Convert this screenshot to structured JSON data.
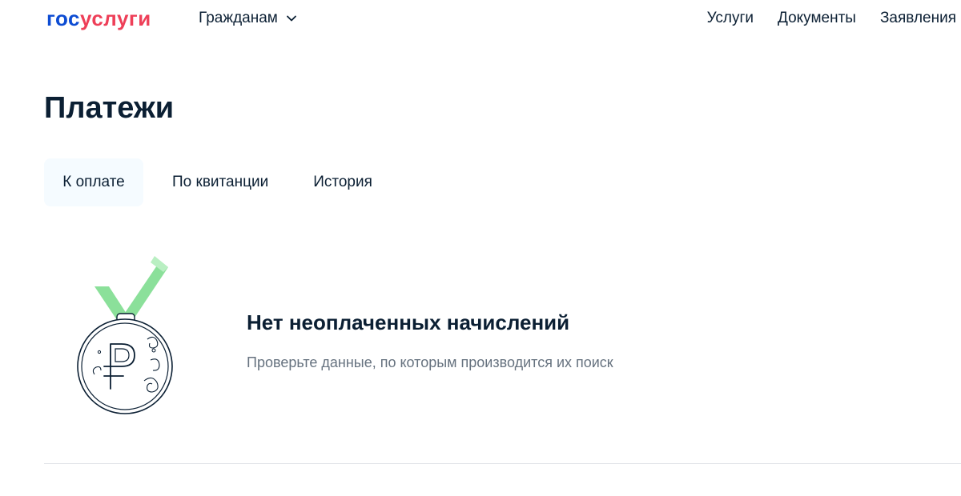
{
  "header": {
    "logo_left": "гос",
    "logo_right": "услуги",
    "audience_label": "Гражданам",
    "nav": [
      "Услуги",
      "Документы",
      "Заявления"
    ]
  },
  "page": {
    "title": "Платежи"
  },
  "tabs": [
    {
      "label": "К оплате",
      "active": true
    },
    {
      "label": "По квитанции",
      "active": false
    },
    {
      "label": "История",
      "active": false
    }
  ],
  "empty_state": {
    "icon": "ruble-medal-icon",
    "title": "Нет неоплаченных начислений",
    "text": "Проверьте данные, по которым производится их поиск"
  },
  "colors": {
    "brand_blue": "#0d4cd3",
    "brand_red": "#ee3f58",
    "ribbon_green": "#8be09a"
  }
}
